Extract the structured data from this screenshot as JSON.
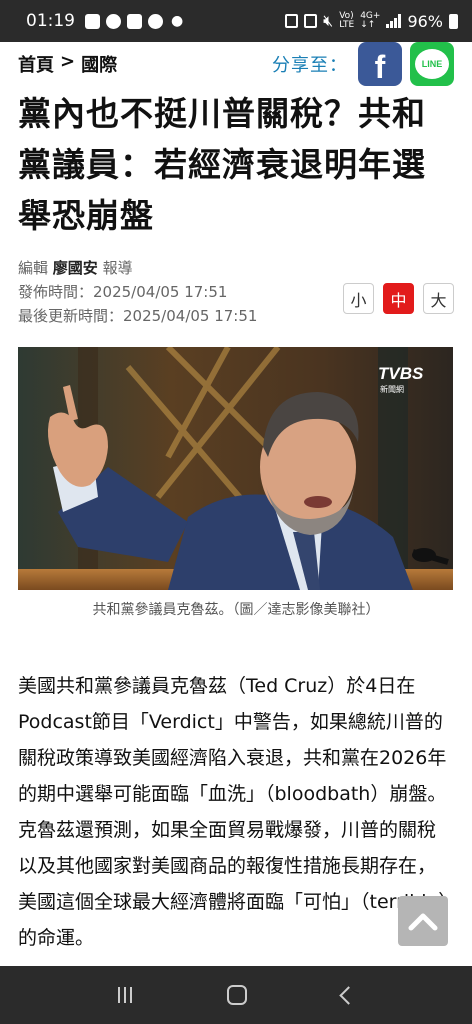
{
  "status_bar": {
    "time": "01:19",
    "battery": "96%",
    "net_top": "Vo)",
    "net_bottom": "LTE",
    "net2_top": "4G+",
    "net2_bottom": "↓↑"
  },
  "header": {
    "breadcrumb_home": "首頁",
    "breadcrumb_sep": ">",
    "breadcrumb_section": "國際",
    "share_label": "分享至：",
    "facebook_glyph": "f",
    "line_label": "LINE"
  },
  "article": {
    "title": "黨內也不挺川普關稅？共和黨議員：若經濟衰退明年選舉恐崩盤",
    "editor_prefix": "編輯",
    "author": "廖國安",
    "editor_suffix": "報導",
    "published": "發佈時間：2025/04/05 17:51",
    "updated": "最後更新時間：2025/04/05 17:51",
    "font_sizes": [
      "小",
      "中",
      "大"
    ],
    "active_font_size": "中",
    "photo_watermark": "TVBS",
    "photo_watermark_sub": "新聞網",
    "photo_caption": "共和黨參議員克魯茲。（圖／達志影像美聯社）",
    "body": "美國共和黨參議員克魯茲（Ted Cruz）於4日在Podcast節目「Verdict」中警告，如果總統川普的關稅政策導致美國經濟陷入衰退，共和黨在2026年的期中選舉可能面臨「血洗」（bloodbath）崩盤。克魯茲還預測，如果全面貿易戰爆發，川普的關稅以及其他國家對美國商品的報復性措施長期存在，美國這個全球最大經濟體將面臨「可怕」（terrible）的命運。"
  },
  "colors": {
    "facebook": "#3b5998",
    "line": "#22c04a",
    "active_font": "#e21b1b",
    "share_label": "#1a7fb5"
  }
}
